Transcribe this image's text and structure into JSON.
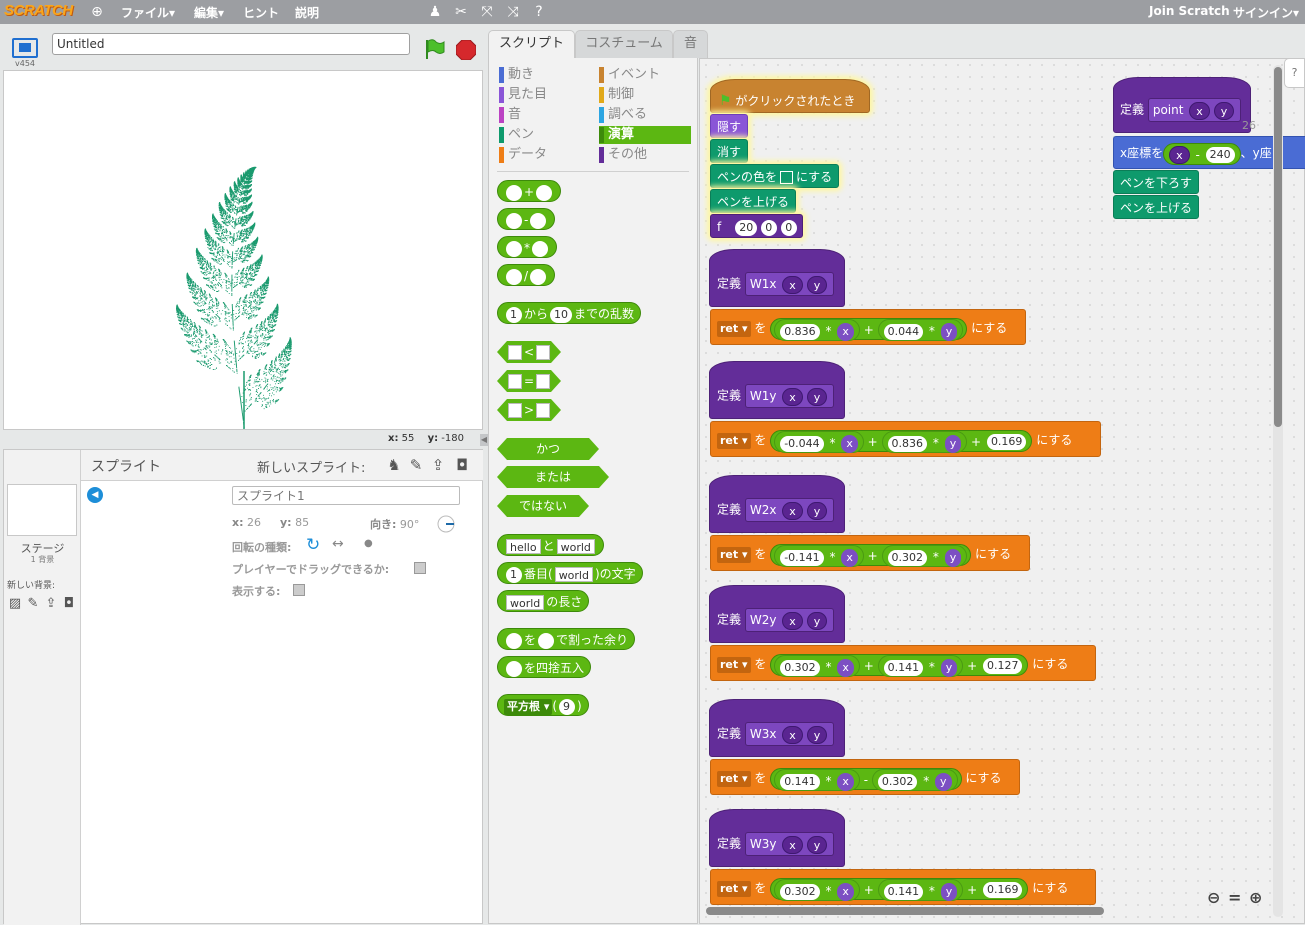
{
  "menubar": {
    "logo": "SCRATCH",
    "file": "ファイル▾",
    "edit": "編集▾",
    "hint": "ヒント",
    "about": "説明",
    "join": "Join Scratch",
    "signin": "サインイン▾"
  },
  "stage": {
    "version": "v454",
    "title": "Untitled",
    "mouse_x_label": "x:",
    "mouse_x": "55",
    "mouse_y_label": "y:",
    "mouse_y": "-180",
    "fern_color": "#1a9a6e"
  },
  "sprites": {
    "title": "スプライト",
    "new_sprite": "新しいスプライト:",
    "stage_label": "ステージ",
    "stage_count": "1 背景",
    "new_backdrop": "新しい背景:",
    "sprite_name_placeholder": "スプライト1",
    "x_label": "x:",
    "x": "26",
    "y_label": "y:",
    "y": "85",
    "dir_label": "向き:",
    "dir": "90°",
    "rot_label": "回転の種類:",
    "drag_label": "プレイヤーでドラッグできるか:",
    "show_label": "表示する:"
  },
  "tabs": [
    "スクリプト",
    "コスチューム",
    "音"
  ],
  "categories": {
    "motion": {
      "label": "動き",
      "color": "#4a6cd4"
    },
    "looks": {
      "label": "見た目",
      "color": "#8a55d7"
    },
    "sound": {
      "label": "音",
      "color": "#bb42c3"
    },
    "pen": {
      "label": "ペン",
      "color": "#0e9a6c"
    },
    "data": {
      "label": "データ",
      "color": "#ee7d16"
    },
    "events": {
      "label": "イベント",
      "color": "#c88330"
    },
    "control": {
      "label": "制御",
      "color": "#e1a91a"
    },
    "sensing": {
      "label": "調べる",
      "color": "#2ca5e2"
    },
    "operators": {
      "label": "演算",
      "color": "#5cb712"
    },
    "more": {
      "label": "その他",
      "color": "#632d99"
    }
  },
  "palette": {
    "add": "+",
    "sub": "-",
    "mul": "*",
    "div": "/",
    "rand_from": "から",
    "rand_a": "1",
    "rand_b": "10",
    "rand_to": "までの乱数",
    "lt": "<",
    "eq": "=",
    "gt": ">",
    "and": "かつ",
    "or": "または",
    "not": "ではない",
    "join_a": "hello",
    "join_mid": "と",
    "join_b": "world",
    "letter_n": "1",
    "letter_mid": "番目(",
    "letter_s": "world",
    "letter_end": ")の文字",
    "len_s": "world",
    "len_end": "の長さ",
    "mod_mid": "を",
    "mod_end": "で割った余り",
    "round_end": "を四捨五入",
    "math_fn": "平方根",
    "math_open": "(",
    "math_arg": "9",
    "math_close": ")"
  },
  "scripts": {
    "when_flag": "がクリックされたとき",
    "hide": "隠す",
    "clear": "消す",
    "set_pen_color": "ペンの色を",
    "set_pen_color_end": "にする",
    "pen_up": "ペンを上げる",
    "pen_down": "ペンを下ろす",
    "f_name": "f",
    "f_args": [
      "20",
      "0",
      "0"
    ],
    "define": "定義",
    "point_name": "point",
    "arg_x": "x",
    "arg_y": "y",
    "set_x_to": "x座標を",
    "set_x_val": "240",
    "set_x_trail": "、y座",
    "ret": "ret",
    "wo": "を",
    "nisuru": "にする",
    "op_mul": "*",
    "op_add": "+",
    "op_sub": "-",
    "hidden_num": "26",
    "defs": [
      {
        "name": "W1x",
        "a": "0.836",
        "b": "0.044",
        "op": "+",
        "c": ""
      },
      {
        "name": "W1y",
        "a": "-0.044",
        "b": "0.836",
        "op": "+",
        "c": "0.169"
      },
      {
        "name": "W2x",
        "a": "-0.141",
        "b": "0.302",
        "op": "+",
        "c": ""
      },
      {
        "name": "W2y",
        "a": "0.302",
        "b": "0.141",
        "op": "+",
        "c": "0.127"
      },
      {
        "name": "W3x",
        "a": "0.141",
        "b": "0.302",
        "op": "-",
        "c": ""
      },
      {
        "name": "W3y",
        "a": "0.302",
        "b": "0.141",
        "op": "+",
        "c": "0.169"
      }
    ]
  }
}
